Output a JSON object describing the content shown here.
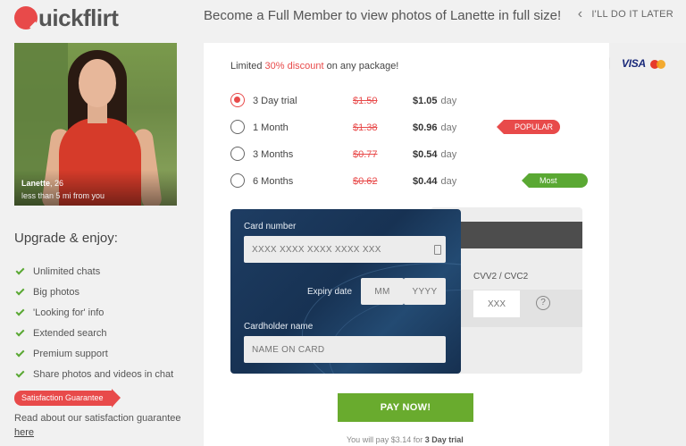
{
  "header": {
    "logo_text": "uickflirt",
    "title": "Become a Full Member to view photos of Lanette in full size!",
    "later_label": "I'LL DO IT LATER"
  },
  "profile": {
    "name": "Lanette",
    "age": ", 26",
    "distance": "less than 5 mi from you"
  },
  "upgrade": {
    "title": "Upgrade & enjoy:",
    "features": [
      "Unlimited chats",
      "Big photos",
      "'Looking for' info",
      "Extended search",
      "Premium support",
      "Share photos and videos in chat"
    ],
    "badge": "Satisfaction Guarantee",
    "guarantee_text": "Read about our satisfaction guarantee",
    "guarantee_link": "here"
  },
  "offer": {
    "prefix": "Limited ",
    "percent": "30% discount",
    "suffix": " on any package!"
  },
  "plans": [
    {
      "name": "3 Day trial",
      "old_price": "$1.50",
      "price": "$1.05",
      "unit": "day",
      "selected": true,
      "tag": ""
    },
    {
      "name": "1 Month",
      "old_price": "$1.38",
      "price": "$0.96",
      "unit": "day",
      "selected": false,
      "tag": "POPULAR"
    },
    {
      "name": "3 Months",
      "old_price": "$0.77",
      "price": "$0.54",
      "unit": "day",
      "selected": false,
      "tag": ""
    },
    {
      "name": "6 Months",
      "old_price": "$0.62",
      "price": "$0.44",
      "unit": "day",
      "selected": false,
      "tag": "Most Savings"
    }
  ],
  "card": {
    "number_label": "Card number",
    "number_placeholder": "XXXX XXXX XXXX XXXX XXX",
    "expiry_label": "Expiry date",
    "month_placeholder": "MM",
    "separator": "/",
    "year_placeholder": "YYYY",
    "holder_label": "Cardholder name",
    "holder_placeholder": "NAME ON CARD",
    "cvv_label": "CVV2 / CVC2",
    "cvv_placeholder": "XXX",
    "help_icon": "?"
  },
  "pay": {
    "button": "PAY NOW!",
    "note_prefix": "You will pay ",
    "amount": "$3.14",
    "note_for": " for ",
    "plan": "3 Day trial"
  },
  "payment_methods": {
    "visa": "VISA",
    "mastercard_icon": "mastercard-icon"
  },
  "colors": {
    "accent_red": "#e84a4a",
    "accent_green": "#69ab2e",
    "card_blue": "#1e3d63"
  }
}
